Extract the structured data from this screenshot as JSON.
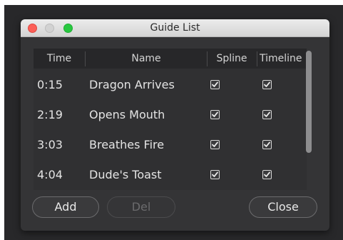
{
  "window": {
    "title": "Guide List"
  },
  "columns": {
    "time": "Time",
    "name": "Name",
    "spline": "Spline",
    "timeline": "Timeline"
  },
  "rows": [
    {
      "time": "0:15",
      "name": "Dragon Arrives",
      "spline": true,
      "timeline": true
    },
    {
      "time": "2:19",
      "name": "Opens Mouth",
      "spline": true,
      "timeline": true
    },
    {
      "time": "3:03",
      "name": "Breathes Fire",
      "spline": true,
      "timeline": true
    },
    {
      "time": "4:04",
      "name": "Dude's Toast",
      "spline": true,
      "timeline": true
    }
  ],
  "buttons": {
    "add": "Add",
    "del": "Del",
    "close": "Close"
  }
}
